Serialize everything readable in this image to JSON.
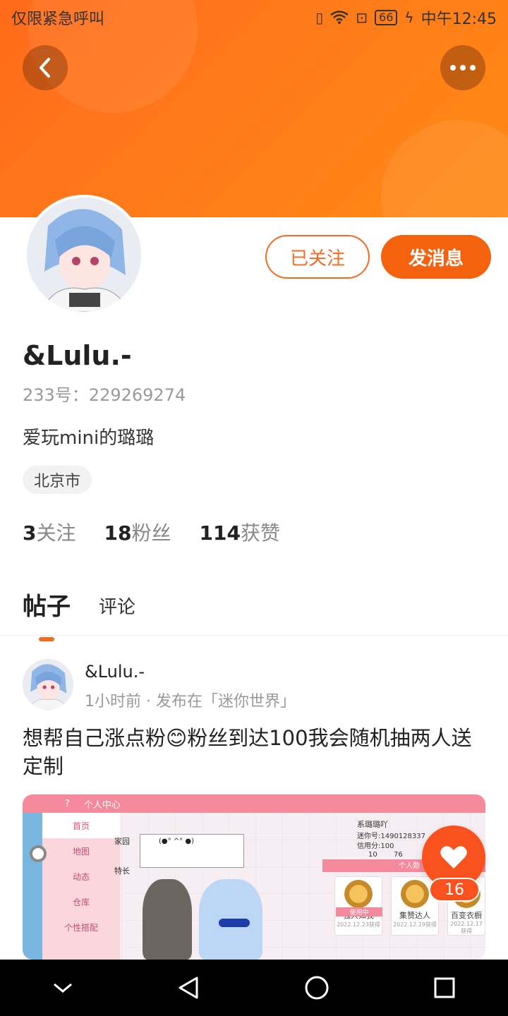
{
  "status_bar": {
    "carrier": "仅限紧急呼叫",
    "battery": "66",
    "time": "中午12:45"
  },
  "header": {
    "back_icon": "chevron-left-icon",
    "more_icon": "ellipsis-icon"
  },
  "profile": {
    "name": "&Lulu.-",
    "id_label": "233号：229269274",
    "bio": "爱玩mini的璐璐",
    "location": "北京市",
    "follow_button": "已关注",
    "message_button": "发消息",
    "stats": [
      {
        "num": "3",
        "label": "关注"
      },
      {
        "num": "18",
        "label": "粉丝"
      },
      {
        "num": "114",
        "label": "获赞"
      }
    ]
  },
  "tabs": [
    {
      "label": "帖子",
      "active": true
    },
    {
      "label": "评论",
      "active": false
    }
  ],
  "post": {
    "author": "&Lulu.-",
    "meta": "1小时前 · 发布在「迷你世界」",
    "text": "想帮自己涨点粉😊粉丝到达100我会随机抽两人送定制",
    "like_count": "16",
    "image": {
      "title": "个人中心",
      "menu": [
        "首页",
        "地图",
        "动态",
        "仓库",
        "个性搭配"
      ],
      "bubble": "(●° ^° ●)",
      "side_labels": [
        "家园",
        "特长"
      ],
      "player_name": "系璐璐吖",
      "mini_id": "迷你号:1490128337",
      "credit": "信用分:100",
      "counts": [
        "10",
        "76"
      ],
      "section": "个人勋",
      "in_use": "使用中",
      "medals": [
        {
          "name": "强大如我",
          "date": "2022.12.23获得"
        },
        {
          "name": "集赞达人",
          "date": "2022.12.19获得"
        },
        {
          "name": "百变衣橱",
          "date": "2022.12.17获得"
        }
      ]
    }
  },
  "colors": {
    "accent": "#f5620f",
    "banner": "#ff7a1a"
  }
}
